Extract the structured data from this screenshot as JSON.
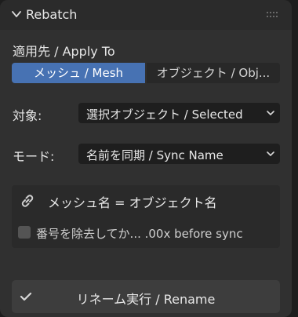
{
  "panel": {
    "title": "Rebatch"
  },
  "apply_to": {
    "label": "適用先 / Apply To",
    "options": [
      {
        "label": "メッシュ / Mesh",
        "selected": true
      },
      {
        "label": "オブジェクト / Obj...",
        "selected": false
      }
    ]
  },
  "target": {
    "label": "対象:",
    "value": "選択オブジェクト / Selected"
  },
  "mode": {
    "label": "モード:",
    "value": "名前を同期 / Sync Name"
  },
  "sync_box": {
    "text": "メッシュ名 = オブジェクト名",
    "checkbox_label": "番号を除去してか... .00x before sync",
    "checkbox_checked": false
  },
  "rename_button": {
    "label": "リネーム実行 / Rename"
  },
  "colors": {
    "accent": "#4772b3",
    "panel_bg": "#303030",
    "field_bg": "#1e1e1e"
  }
}
